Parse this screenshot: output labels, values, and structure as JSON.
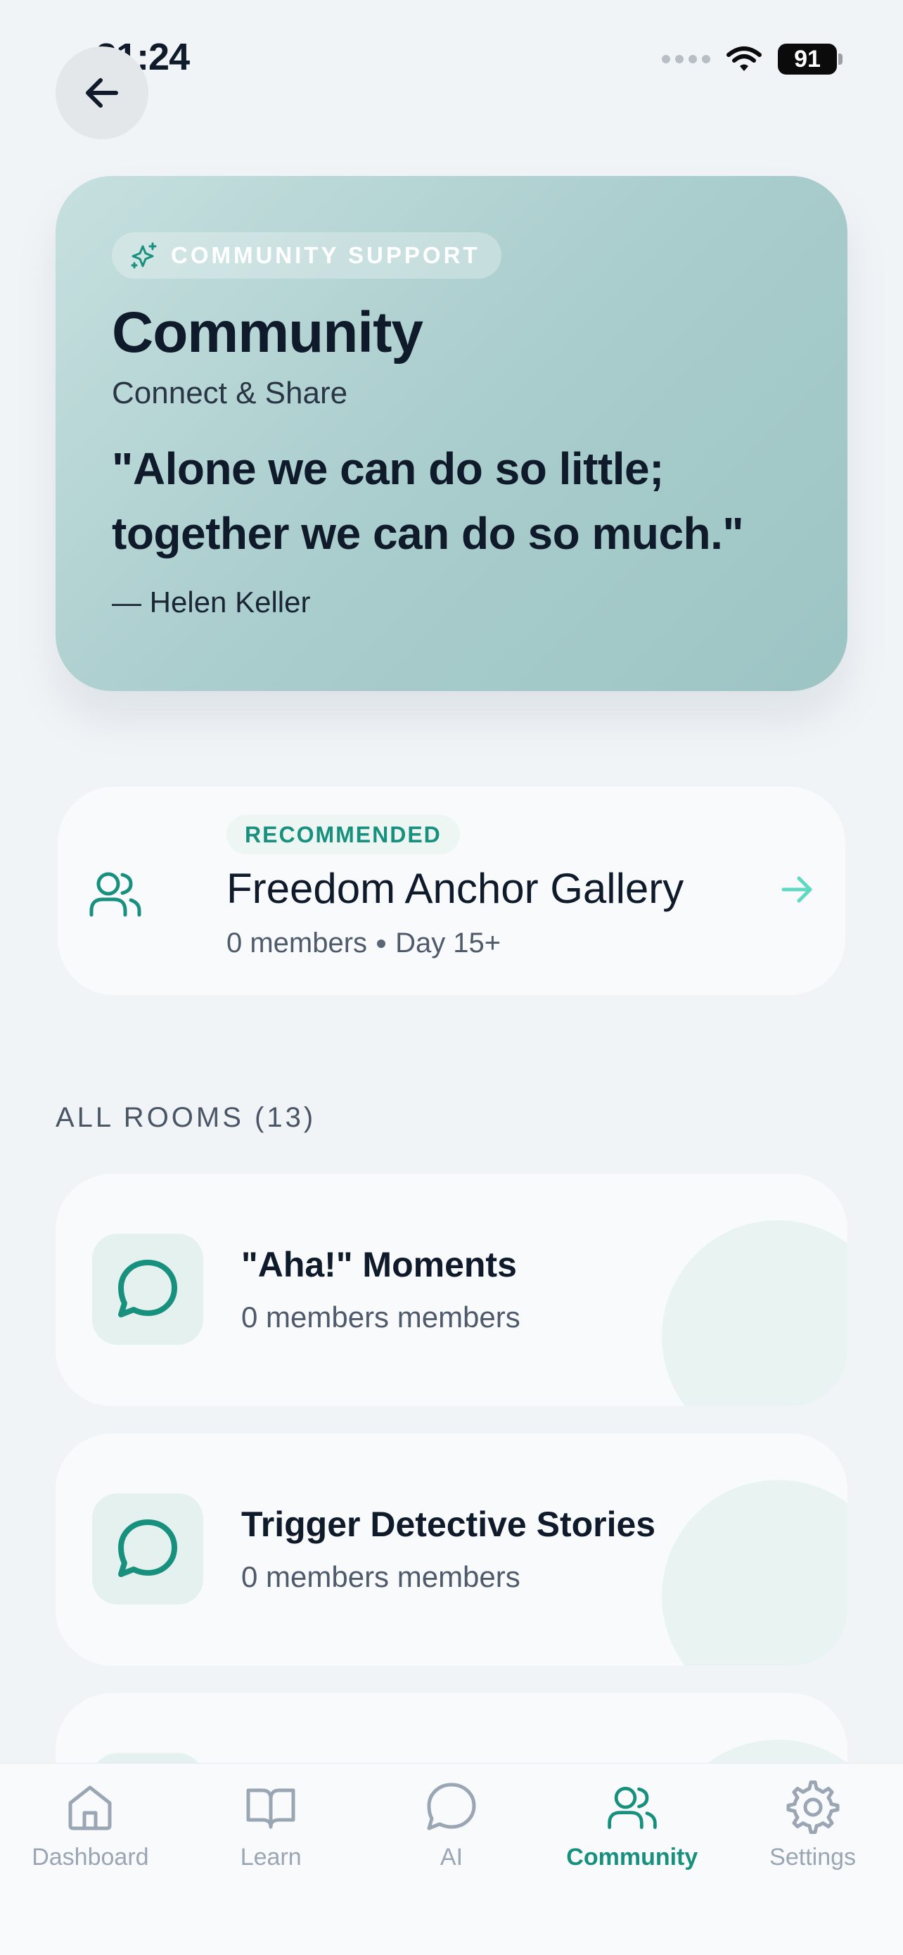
{
  "status_bar": {
    "time": "21:24",
    "battery": "91"
  },
  "hero": {
    "badge": "COMMUNITY SUPPORT",
    "title": "Community",
    "subtitle": "Connect & Share",
    "quote_line1": "\"Alone we can do so little;",
    "quote_line2": "together we can do so much.\"",
    "author": "— Helen Keller"
  },
  "recommended": {
    "badge": "RECOMMENDED",
    "title": "Freedom Anchor Gallery",
    "members": "0 members",
    "day": "Day 15+"
  },
  "rooms": {
    "title": "ALL ROOMS (13)",
    "items": [
      {
        "name": "\"Aha!\" Moments",
        "members": "0 members members"
      },
      {
        "name": "Trigger Detective Stories",
        "members": "0 members members"
      },
      {
        "name": "",
        "members": ""
      }
    ]
  },
  "nav": {
    "items": [
      {
        "label": "Dashboard"
      },
      {
        "label": "Learn"
      },
      {
        "label": "AI"
      },
      {
        "label": "Community"
      },
      {
        "label": "Settings"
      }
    ],
    "active": "Community"
  },
  "colors": {
    "accent": "#17907e",
    "nav_inactive": "#9aa6b4",
    "hero_start": "#c6e0df",
    "hero_end": "#9dc4c4",
    "background": "#f1f4f7"
  }
}
